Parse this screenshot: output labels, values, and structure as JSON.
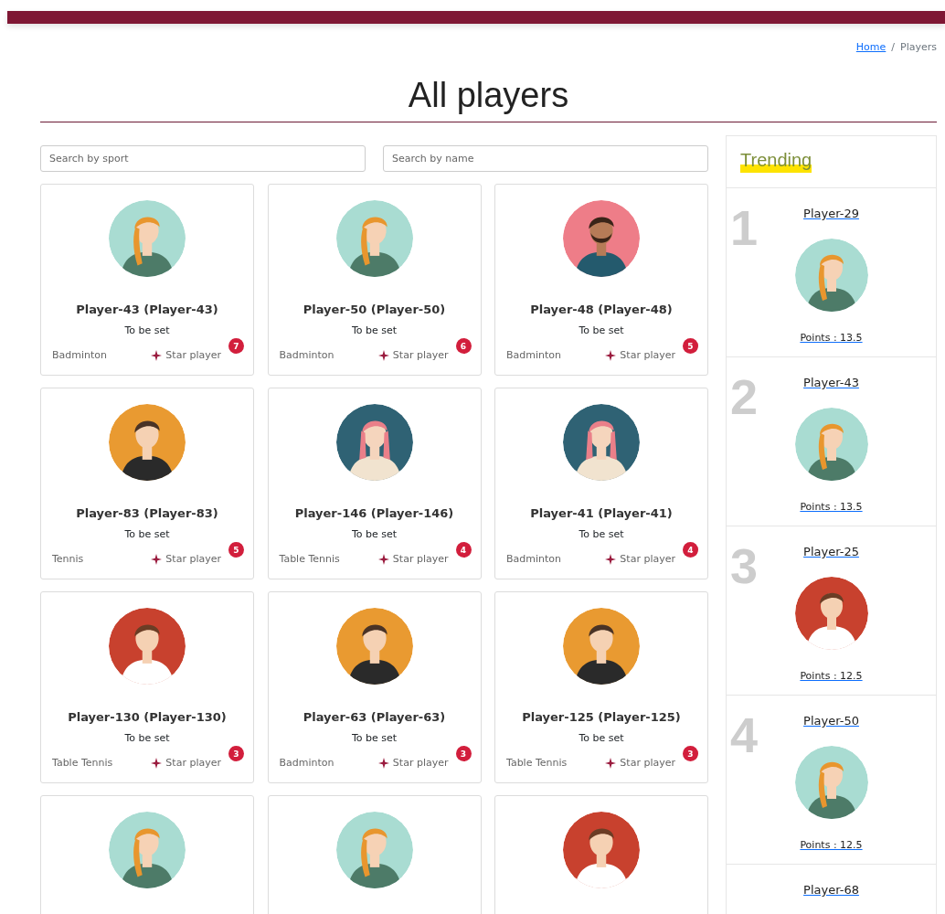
{
  "breadcrumb": [
    {
      "label": "Home",
      "link": true
    },
    {
      "label": "Players",
      "link": false
    }
  ],
  "breadcrumb_separator": "/",
  "title": "All players",
  "search": [
    {
      "placeholder": "Search by sport"
    },
    {
      "placeholder": "Search by name"
    }
  ],
  "players": [
    {
      "avatar": {
        "kind": "braid"
      },
      "name": "Player-43 (Player-43)",
      "status": "To be set",
      "sport": "Badminton",
      "tag": "Star player",
      "count": "7"
    },
    {
      "avatar": {
        "kind": "braid"
      },
      "name": "Player-50 (Player-50)",
      "status": "To be set",
      "sport": "Badminton",
      "tag": "Star player",
      "count": "6"
    },
    {
      "avatar": {
        "kind": "beard"
      },
      "name": "Player-48 (Player-48)",
      "status": "To be set",
      "sport": "Badminton",
      "tag": "Star player",
      "count": "5"
    },
    {
      "avatar": {
        "kind": "suit"
      },
      "name": "Player-83 (Player-83)",
      "status": "To be set",
      "sport": "Tennis",
      "tag": "Star player",
      "count": "5"
    },
    {
      "avatar": {
        "kind": "pink"
      },
      "name": "Player-146 (Player-146)",
      "status": "To be set",
      "sport": "Table Tennis",
      "tag": "Star player",
      "count": "4"
    },
    {
      "avatar": {
        "kind": "pink"
      },
      "name": "Player-41 (Player-41)",
      "status": "To be set",
      "sport": "Badminton",
      "tag": "Star player",
      "count": "4"
    },
    {
      "avatar": {
        "kind": "red"
      },
      "name": "Player-130 (Player-130)",
      "status": "To be set",
      "sport": "Table Tennis",
      "tag": "Star player",
      "count": "3"
    },
    {
      "avatar": {
        "kind": "suit"
      },
      "name": "Player-63 (Player-63)",
      "status": "To be set",
      "sport": "Badminton",
      "tag": "Star player",
      "count": "3"
    },
    {
      "avatar": {
        "kind": "suit"
      },
      "name": "Player-125 (Player-125)",
      "status": "To be set",
      "sport": "Table Tennis",
      "tag": "Star player",
      "count": "3"
    },
    {
      "avatar": {
        "kind": "braid"
      }
    },
    {
      "avatar": {
        "kind": "braid"
      }
    },
    {
      "avatar": {
        "kind": "red"
      }
    }
  ],
  "trending": {
    "title": "Trending",
    "items": [
      {
        "rank": "1",
        "name": "Player-29",
        "avatar": {
          "kind": "braid"
        },
        "points": "Points : 13.5"
      },
      {
        "rank": "2",
        "name": "Player-43",
        "avatar": {
          "kind": "braid"
        },
        "points": "Points : 13.5"
      },
      {
        "rank": "3",
        "name": "Player-25",
        "avatar": {
          "kind": "red"
        },
        "points": "Points : 12.5"
      },
      {
        "rank": "4",
        "name": "Player-50",
        "avatar": {
          "kind": "braid"
        },
        "points": "Points : 12.5"
      },
      {
        "name": "Player-68"
      }
    ]
  }
}
